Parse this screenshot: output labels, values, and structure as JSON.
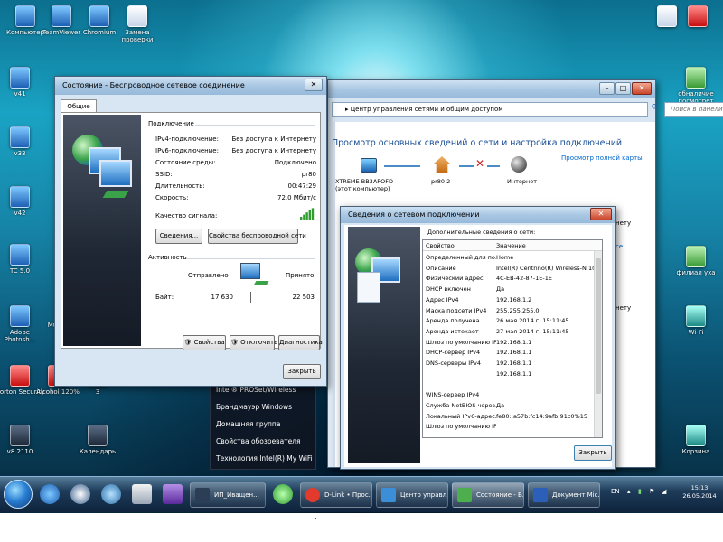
{
  "desktop": {
    "icons": [
      {
        "label": "Компьютер",
        "class": "ico-blue"
      },
      {
        "label": "TeamViewer",
        "class": "ico-blue"
      },
      {
        "label": "Chromium",
        "class": "ico-blue"
      },
      {
        "label": "Замена проверки",
        "class": "ico-doc"
      },
      {
        "label": "v41",
        "class": "ico-blue"
      },
      {
        "label": "v33",
        "class": "ico-blue"
      },
      {
        "label": "v42",
        "class": "ico-blue"
      },
      {
        "label": "TC 5.0",
        "class": "ico-blue"
      },
      {
        "label": "Adobe Photosh...",
        "class": "ico-blue"
      },
      {
        "label": "Mu",
        "class": "ico-dark"
      },
      {
        "label": "Norton Security",
        "class": "ico-red"
      },
      {
        "label": "Alcohol 120%",
        "class": "ico-red"
      },
      {
        "label": "3",
        "class": "ico-doc"
      },
      {
        "label": "v8 2110",
        "class": "ico-dark"
      },
      {
        "label": "Календарь",
        "class": "ico-dark"
      },
      {
        "label": "обналичие посмотрет",
        "class": "ico-green"
      },
      {
        "label": "филиал уха",
        "class": "ico-green"
      },
      {
        "label": "Корзина",
        "class": "ico-teal"
      },
      {
        "label": "Wi-Fi",
        "class": "ico-teal"
      }
    ]
  },
  "main_window": {
    "breadcrumb": "▸ Центр управления сетями и общим доступом",
    "search_placeholder": "Поиск в панели управления",
    "heading": "Просмотр основных сведений о сети и настройка подключений",
    "full_map_link": "Просмотр полной карты",
    "map": {
      "computer_label": "XTREME-BB3APOFD\n(этот компьютер)",
      "network_label": "pr80 2",
      "internet_label": "Интернет"
    },
    "side_texts": [
      "нету",
      "се",
      "нету"
    ]
  },
  "status_dialog": {
    "title": "Состояние - Беспроводное сетевое соединение",
    "tab": "Общие",
    "section_connection": "Подключение",
    "fields": [
      {
        "label": "IPv4-подключение:",
        "value": "Без доступа к Интернету"
      },
      {
        "label": "IPv6-подключение:",
        "value": "Без доступа к Интернету"
      },
      {
        "label": "Состояние среды:",
        "value": "Подключено"
      },
      {
        "label": "SSID:",
        "value": "pr80"
      },
      {
        "label": "Длительность:",
        "value": "00:47:29"
      },
      {
        "label": "Скорость:",
        "value": "72.0 Мбит/с"
      }
    ],
    "signal_label": "Качество сигнала:",
    "signal_bars": 5,
    "btn_details": "Сведения...",
    "btn_wireless_props": "Свойства беспроводной сети",
    "section_activity": "Активность",
    "sent_label": "Отправлено",
    "received_label": "Принято",
    "bytes_label": "Байт:",
    "bytes_sent": "17 630",
    "bytes_received": "22 503",
    "btn_properties": "Свойства",
    "btn_disable": "Отключить",
    "btn_diagnose": "Диагностика",
    "btn_close": "Закрыть"
  },
  "details_dialog": {
    "title": "Сведения о сетевом подключении",
    "section": "Дополнительные сведения о сети:",
    "col_property": "Свойство",
    "col_value": "Значение",
    "rows": [
      {
        "p": "Определенный для по...",
        "v": "Home"
      },
      {
        "p": "Описание",
        "v": "Intel(R) Centrino(R) Wireless-N 1030"
      },
      {
        "p": "Физический адрес",
        "v": "4C-EB-42-87-1E-1E"
      },
      {
        "p": "DHCP включен",
        "v": "Да"
      },
      {
        "p": "Адрес IPv4",
        "v": "192.168.1.2"
      },
      {
        "p": "Маска подсети IPv4",
        "v": "255.255.255.0"
      },
      {
        "p": "Аренда получена",
        "v": "26 мая 2014 г. 15:11:45"
      },
      {
        "p": "Аренда истекает",
        "v": "27 мая 2014 г. 15:11:45"
      },
      {
        "p": "Шлюз по умолчанию IP...",
        "v": "192.168.1.1"
      },
      {
        "p": "DHCP-сервер IPv4",
        "v": "192.168.1.1"
      },
      {
        "p": "DNS-серверы IPv4",
        "v": "192.168.1.1"
      },
      {
        "p": "",
        "v": "192.168.1.1"
      },
      {
        "p": "",
        "v": ""
      },
      {
        "p": "WINS-сервер IPv4",
        "v": ""
      },
      {
        "p": "Служба NetBIOS через...",
        "v": "Да"
      },
      {
        "p": "Локальный IPv6-адрес...",
        "v": "fe80::a57b:fc14:9afb:91c0%15"
      },
      {
        "p": "Шлюз по умолчанию IP...",
        "v": ""
      }
    ],
    "btn_close": "Закрыть"
  },
  "jump_menu": {
    "items": [
      "Intel® PROSet/Wireless",
      "Брандмауэр Windows",
      "Домашняя группа",
      "Свойства обозревателя",
      "Технология Intel(R) My WiFi"
    ]
  },
  "taskbar": {
    "items": [
      {
        "label": "ИП_Иващен...",
        "color": "#2c3e55"
      },
      {
        "label": "D-Link • Прос...",
        "color": "#e23b2e"
      },
      {
        "label": "Центр управл...",
        "color": "#3c8fd6"
      },
      {
        "label": "Состояние - Б...",
        "color": "#4cae4c"
      },
      {
        "label": "Документ Mic...",
        "color": "#2b5fb8"
      }
    ],
    "lang": "EN",
    "time": "15:13",
    "date": "26.05.2014"
  },
  "colors": {
    "accent": "#1a5ea8",
    "link": "#0066cc",
    "error_x": "#d0201c"
  }
}
